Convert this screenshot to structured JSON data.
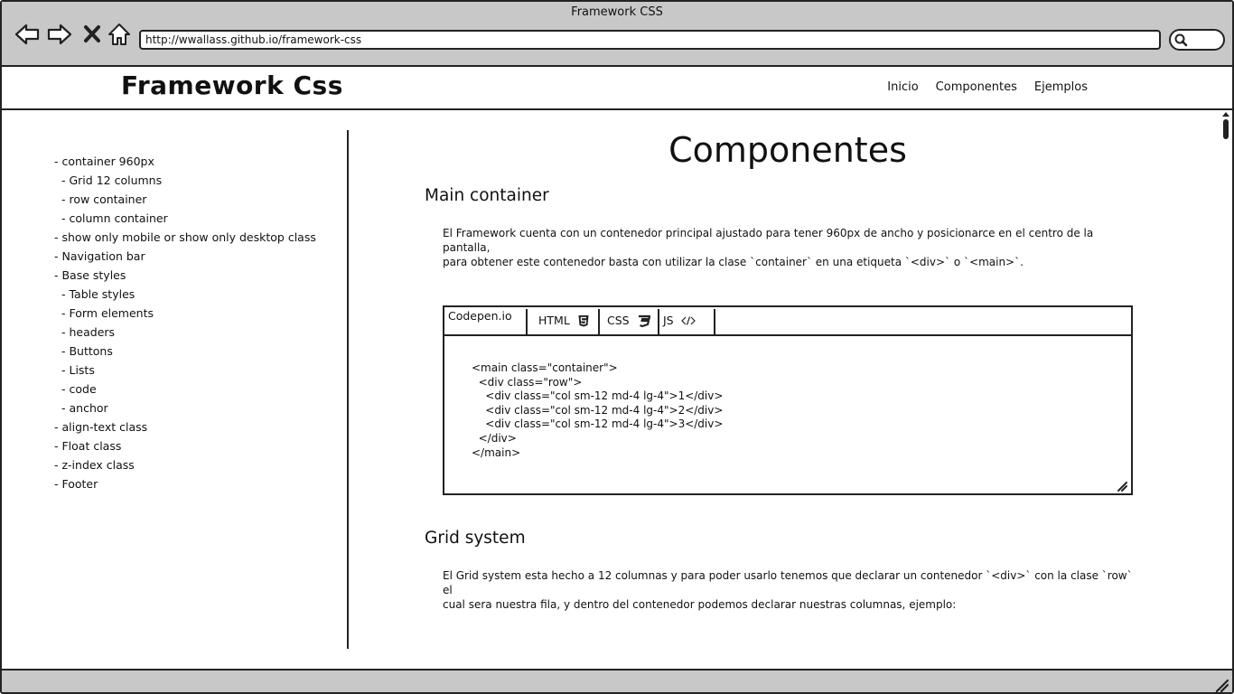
{
  "window": {
    "title": "Framework CSS",
    "url": "http://wwallass.github.io/framework-css"
  },
  "header": {
    "brand": "Framework Css",
    "nav": [
      "Inicio",
      "Componentes",
      "Ejemplos"
    ]
  },
  "sidebar": {
    "items": [
      {
        "label": "- container 960px",
        "level": 0
      },
      {
        "label": "- Grid 12 columns",
        "level": 1
      },
      {
        "label": "- row container",
        "level": 1
      },
      {
        "label": "- column container",
        "level": 1
      },
      {
        "label": "- show only mobile or show only desktop class",
        "level": 0
      },
      {
        "label": "- Navigation bar",
        "level": 0
      },
      {
        "label": "- Base styles",
        "level": 0
      },
      {
        "label": "- Table styles",
        "level": 1
      },
      {
        "label": "- Form elements",
        "level": 1
      },
      {
        "label": "- headers",
        "level": 1
      },
      {
        "label": "- Buttons",
        "level": 1
      },
      {
        "label": "- Lists",
        "level": 1
      },
      {
        "label": "- code",
        "level": 1
      },
      {
        "label": "- anchor",
        "level": 1
      },
      {
        "label": "- align-text class",
        "level": 0
      },
      {
        "label": "- Float class",
        "level": 0
      },
      {
        "label": "- z-index class",
        "level": 0
      },
      {
        "label": "- Footer",
        "level": 0
      }
    ]
  },
  "main": {
    "title": "Componentes",
    "sections": [
      {
        "heading": "Main container",
        "text_lines": [
          "El Framework cuenta con un contenedor principal ajustado para tener 960px de ancho y posicionarce en el centro de la pantalla,",
          "para obtener este contenedor basta con utilizar la clase `container` en una etiqueta `<div>` o  `<main>`."
        ]
      },
      {
        "heading": "Grid system",
        "text_lines": [
          "El Grid system esta hecho a 12 columnas y para poder usarlo tenemos que declarar un contenedor `<div>` con la clase `row` el",
          "cual sera nuestra fila, y dentro del contenedor podemos declarar nuestras columnas, ejemplo:"
        ]
      }
    ],
    "codepen": {
      "label": "Codepen.io",
      "tabs": [
        "HTML",
        "CSS",
        "JS"
      ],
      "code": "<main class=\"container\">\n  <div class=\"row\">\n    <div class=\"col sm-12 md-4 lg-4\">1</div>\n    <div class=\"col sm-12 md-4 lg-4\">2</div>\n    <div class=\"col sm-12 md-4 lg-4\">3</div>\n  </div>\n</main>"
    }
  },
  "icons": {
    "back": "back-arrow-icon",
    "forward": "forward-arrow-icon",
    "stop": "close-icon",
    "home": "home-icon",
    "search": "search-icon",
    "html5": "html5-icon",
    "css3": "css3-icon",
    "code": "code-icon",
    "resize": "resize-grip-icon"
  },
  "colors": {
    "chrome": "#c8c8c8",
    "ink": "#222222",
    "background": "#ffffff"
  }
}
